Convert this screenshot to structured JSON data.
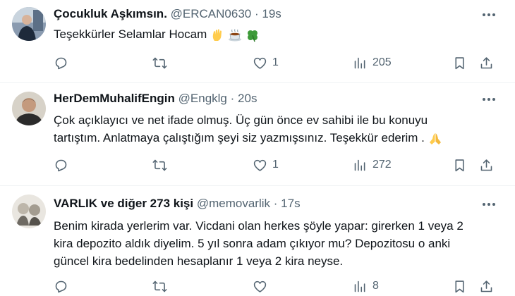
{
  "tweets": [
    {
      "name": "Çocukluk Aşkımsın.",
      "handle": "@ERCAN0630",
      "sep": "·",
      "time": "19s",
      "lines": [
        "Teşekkürler Selamlar Hocam"
      ],
      "emojis": [
        "waving-hand-icon",
        "hot-beverage-icon",
        "four-leaf-clover-icon"
      ],
      "replies": "",
      "retweets": "",
      "likes": "1",
      "views": "205"
    },
    {
      "name": "HerDemMuhalifEngin",
      "handle": "@Engklg",
      "sep": "·",
      "time": "20s",
      "lines": [
        "Çok açıklayıcı ve net ifade olmuş. Üç gün önce ev sahibi ile bu konuyu",
        "tartıştım. Anlatmaya çalıştığım şeyi siz yazmışsınız. Teşekkür ederim ."
      ],
      "emojis": [
        "folded-hands-icon"
      ],
      "replies": "",
      "retweets": "",
      "likes": "1",
      "views": "272"
    },
    {
      "name": "VARLIK ve diğer 273 kişi",
      "handle": "@memovarlik",
      "sep": "·",
      "time": "17s",
      "lines": [
        "Benim kirada yerlerim var. Vicdani olan herkes şöyle yapar: girerken 1 veya 2",
        "kira depozito aldık diyelim. 5 yıl sonra adam çıkıyor mu? Depozitosu o anki",
        "güncel kira bedelinden hesaplanır 1 veya 2 kira neyse."
      ],
      "emojis": [],
      "replies": "",
      "retweets": "",
      "likes": "",
      "views": "8"
    }
  ],
  "colors": {
    "text": "#0f1419",
    "muted": "#536471",
    "divider": "#eff3f4"
  }
}
